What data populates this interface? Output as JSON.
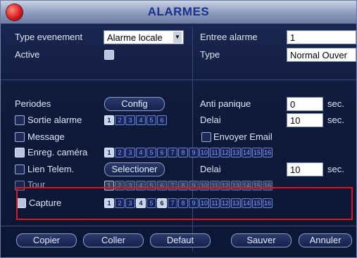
{
  "window": {
    "title": "ALARMES"
  },
  "rows": {
    "type_evenement": {
      "label": "Type evenement",
      "value": "Alarme locale"
    },
    "entree_alarme": {
      "label": "Entree alarme",
      "value": "1"
    },
    "active": {
      "label": "Active"
    },
    "type": {
      "label": "Type",
      "value": "Normal Ouver"
    },
    "periodes": {
      "label": "Periodes",
      "button": "Config"
    },
    "anti_panique": {
      "label": "Anti panique",
      "value": "0",
      "unit": "sec."
    },
    "sortie_alarme": {
      "label": "Sortie alarme",
      "channels": [
        "1",
        "2",
        "3",
        "4",
        "5",
        "6"
      ],
      "on": [
        0
      ]
    },
    "delai1": {
      "label": "Delai",
      "value": "10",
      "unit": "sec."
    },
    "message": {
      "label": "Message"
    },
    "envoyer_email": {
      "label": "Envoyer Email"
    },
    "enreg_camera": {
      "label": "Enreg. caméra",
      "channels": [
        "1",
        "2",
        "3",
        "4",
        "5",
        "6",
        "7",
        "8",
        "9",
        "10",
        "11",
        "12",
        "13",
        "14",
        "15",
        "16"
      ],
      "on": [
        0
      ]
    },
    "lien_telem": {
      "label": "Lien Telem.",
      "button": "Selectioner"
    },
    "delai2": {
      "label": "Delai",
      "value": "10",
      "unit": "sec."
    },
    "tour": {
      "label": "Tour",
      "channels": [
        "1",
        "2",
        "3",
        "4",
        "5",
        "6",
        "7",
        "8",
        "9",
        "10",
        "11",
        "12",
        "13",
        "14",
        "15",
        "16"
      ],
      "on": [
        0
      ]
    },
    "capture": {
      "label": "Capture",
      "channels": [
        "1",
        "2",
        "3",
        "4",
        "5",
        "6",
        "7",
        "8",
        "9",
        "10",
        "11",
        "12",
        "13",
        "14",
        "15",
        "16"
      ],
      "on": [
        0,
        3,
        5
      ]
    }
  },
  "buttons": {
    "copier": "Copier",
    "coller": "Coller",
    "defaut": "Defaut",
    "sauver": "Sauver",
    "annuler": "Annuler"
  },
  "colors": {
    "highlight": "#e0141b",
    "title": "#1b2f8f"
  }
}
